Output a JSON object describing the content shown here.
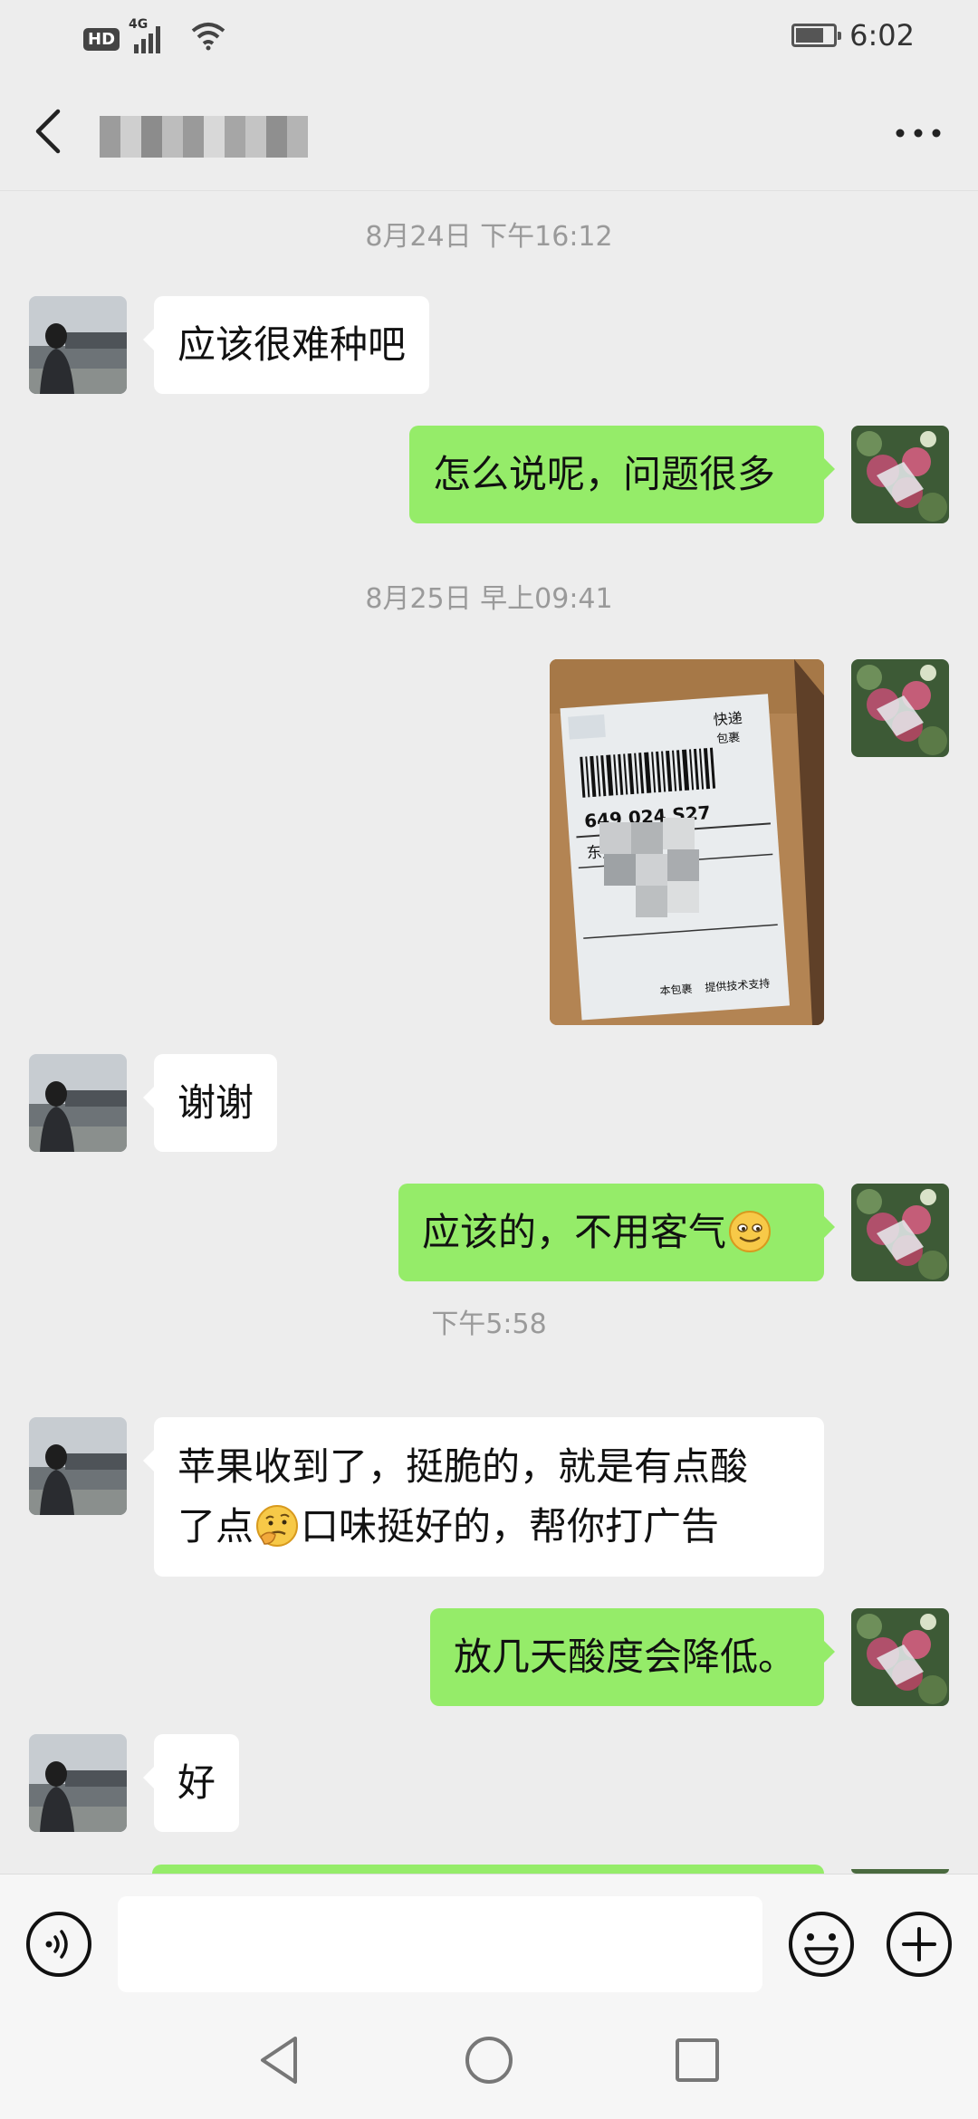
{
  "status_bar": {
    "hd": "HD",
    "network": "4G",
    "time": "6:02",
    "battery_level": 0.75
  },
  "header": {
    "contact_name": "",
    "icons": {
      "back": "chevron-left-icon",
      "more": "more-dots-icon"
    }
  },
  "messages": [
    {
      "type": "timestamp",
      "text": "8月24日 下午16:12"
    },
    {
      "type": "text",
      "side": "in",
      "text": "应该很难种吧"
    },
    {
      "type": "text",
      "side": "out",
      "text": "怎么说呢，问题很多"
    },
    {
      "type": "timestamp",
      "text": "8月25日 早上09:41"
    },
    {
      "type": "image",
      "side": "out",
      "label": {
        "brand": "快递",
        "sub": "包裹",
        "code": "649 024 S27",
        "city": "东莞黄江",
        "footer": "本包裹",
        "footer2": "提供技术支持"
      }
    },
    {
      "type": "text",
      "side": "in",
      "text": "谢谢"
    },
    {
      "type": "text",
      "side": "out",
      "text": "应该的，不用客气",
      "emoji": "smiling-face-emoji"
    },
    {
      "type": "timestamp",
      "text": "下午5:58"
    },
    {
      "type": "text",
      "side": "in",
      "line1": "苹果收到了，挺脆的，就是有点酸",
      "line2_before": "了点",
      "emoji": "thinking-face-emoji",
      "line2_after": "口味挺好的，帮你打广告"
    },
    {
      "type": "text",
      "side": "out",
      "text": "放几天酸度会降低。"
    },
    {
      "type": "text",
      "side": "in",
      "text": "好"
    }
  ],
  "input_bar": {
    "input_value": "",
    "icons": {
      "voice": "voice-icon",
      "emoji": "emoji-icon",
      "plus": "plus-icon"
    }
  },
  "nav_bar": {
    "icons": {
      "back": "nav-back-icon",
      "home": "nav-home-icon",
      "recents": "nav-recents-icon"
    }
  },
  "colors": {
    "chat_background": "#ededed",
    "incoming_bubble": "#ffffff",
    "outgoing_bubble": "#95ec69",
    "timestamp": "#9a9a9a"
  }
}
